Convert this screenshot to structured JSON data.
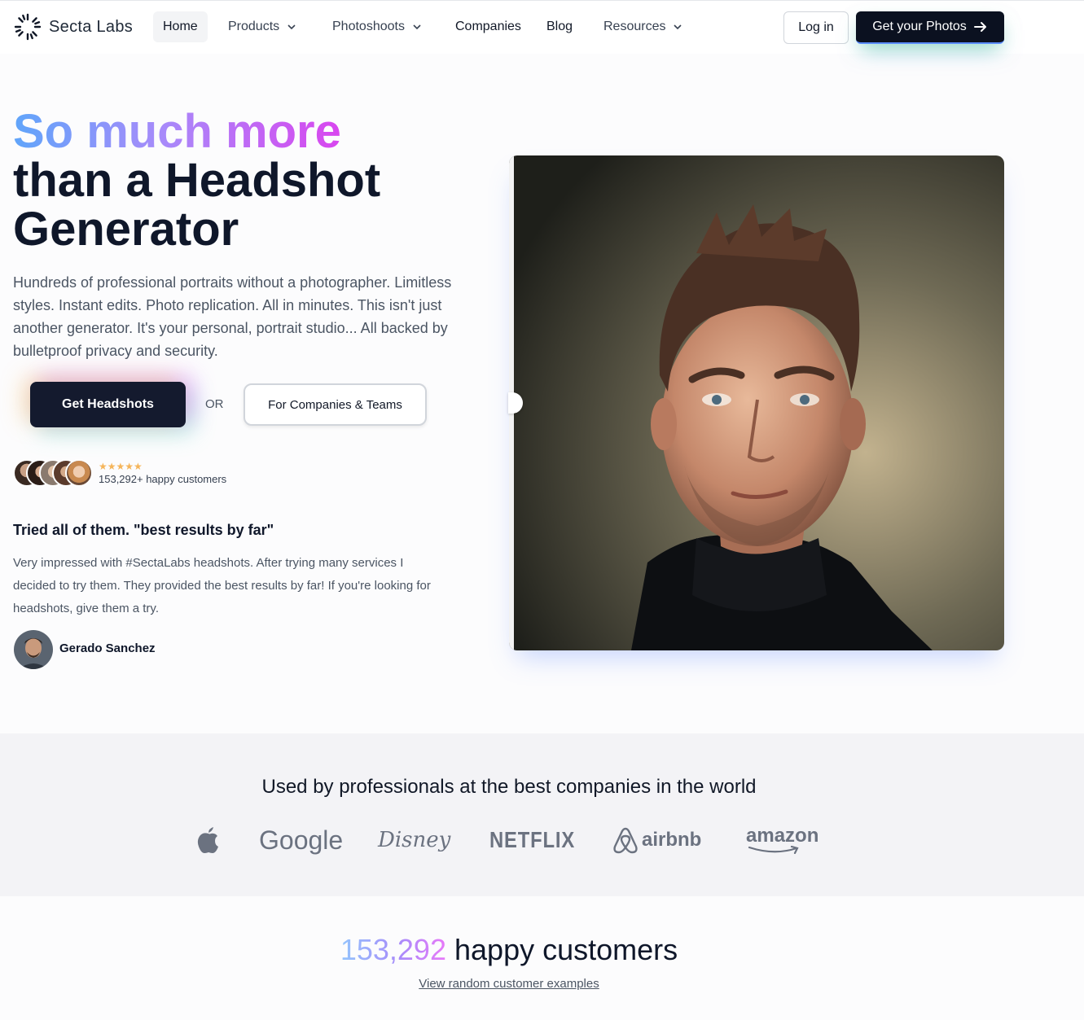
{
  "nav": {
    "logo_text": "Secta Labs",
    "links": [
      {
        "label": "Home",
        "has_dropdown": false
      },
      {
        "label": "Products",
        "has_dropdown": true
      },
      {
        "label": "Photoshoots",
        "has_dropdown": true
      },
      {
        "label": "Companies",
        "has_dropdown": false
      },
      {
        "label": "Blog",
        "has_dropdown": false
      },
      {
        "label": "Resources",
        "has_dropdown": true
      }
    ],
    "login_label": "Log in",
    "cta_label": "Get your Photos"
  },
  "hero": {
    "title_line1": "So much more",
    "title_line2": "than a Headshot",
    "title_line3": "Generator",
    "description": "Hundreds of professional portraits without a photographer. Limitless styles. Instant edits. Photo replication. All in minutes. This isn't just another generator. It's your personal, portrait studio... All backed by bulletproof privacy and security.",
    "primary_cta": "Get Headshots",
    "or_text": "OR",
    "secondary_cta": "For Companies & Teams",
    "rating_stars": "★★★★★",
    "customers_text": "153,292+ happy customers"
  },
  "review": {
    "title": "Tried all of them. \"best results by far\"",
    "text": "Very impressed with #SectaLabs headshots. After trying many services I decided to try them. They provided the best results by far! If you're looking for headshots, give them a try.",
    "author": "Gerado Sanchez"
  },
  "companies": {
    "title": "Used by professionals at the best companies in the world",
    "logos": [
      "apple",
      "Google",
      "Disney",
      "NETFLIX",
      "airbnb",
      "amazon"
    ]
  },
  "stats": {
    "count": "153,292",
    "label": "happy customers",
    "link": "View random customer examples"
  },
  "colors": {
    "primary_dark": "#141a2e",
    "gradient_start": "#60a5fa",
    "gradient_end": "#d946ef",
    "band_bg": "#f3f3f6"
  }
}
